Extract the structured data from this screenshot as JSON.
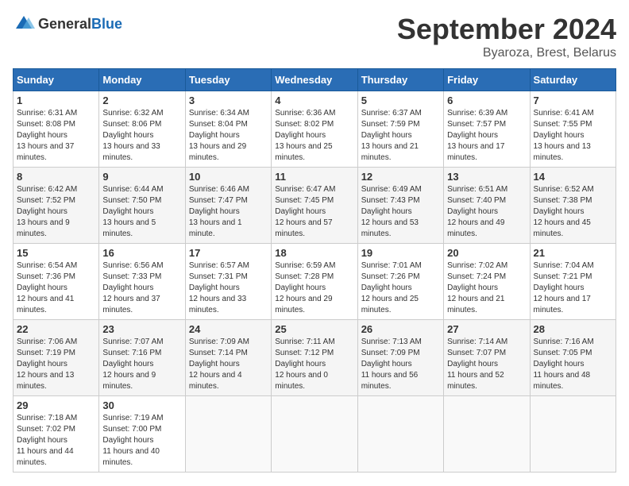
{
  "header": {
    "logo_general": "General",
    "logo_blue": "Blue",
    "month": "September 2024",
    "location": "Byaroza, Brest, Belarus"
  },
  "days_of_week": [
    "Sunday",
    "Monday",
    "Tuesday",
    "Wednesday",
    "Thursday",
    "Friday",
    "Saturday"
  ],
  "weeks": [
    [
      {
        "day": 1,
        "sunrise": "6:31 AM",
        "sunset": "8:08 PM",
        "daylight": "13 hours and 37 minutes."
      },
      {
        "day": 2,
        "sunrise": "6:32 AM",
        "sunset": "8:06 PM",
        "daylight": "13 hours and 33 minutes."
      },
      {
        "day": 3,
        "sunrise": "6:34 AM",
        "sunset": "8:04 PM",
        "daylight": "13 hours and 29 minutes."
      },
      {
        "day": 4,
        "sunrise": "6:36 AM",
        "sunset": "8:02 PM",
        "daylight": "13 hours and 25 minutes."
      },
      {
        "day": 5,
        "sunrise": "6:37 AM",
        "sunset": "7:59 PM",
        "daylight": "13 hours and 21 minutes."
      },
      {
        "day": 6,
        "sunrise": "6:39 AM",
        "sunset": "7:57 PM",
        "daylight": "13 hours and 17 minutes."
      },
      {
        "day": 7,
        "sunrise": "6:41 AM",
        "sunset": "7:55 PM",
        "daylight": "13 hours and 13 minutes."
      }
    ],
    [
      {
        "day": 8,
        "sunrise": "6:42 AM",
        "sunset": "7:52 PM",
        "daylight": "13 hours and 9 minutes."
      },
      {
        "day": 9,
        "sunrise": "6:44 AM",
        "sunset": "7:50 PM",
        "daylight": "13 hours and 5 minutes."
      },
      {
        "day": 10,
        "sunrise": "6:46 AM",
        "sunset": "7:47 PM",
        "daylight": "13 hours and 1 minute."
      },
      {
        "day": 11,
        "sunrise": "6:47 AM",
        "sunset": "7:45 PM",
        "daylight": "12 hours and 57 minutes."
      },
      {
        "day": 12,
        "sunrise": "6:49 AM",
        "sunset": "7:43 PM",
        "daylight": "12 hours and 53 minutes."
      },
      {
        "day": 13,
        "sunrise": "6:51 AM",
        "sunset": "7:40 PM",
        "daylight": "12 hours and 49 minutes."
      },
      {
        "day": 14,
        "sunrise": "6:52 AM",
        "sunset": "7:38 PM",
        "daylight": "12 hours and 45 minutes."
      }
    ],
    [
      {
        "day": 15,
        "sunrise": "6:54 AM",
        "sunset": "7:36 PM",
        "daylight": "12 hours and 41 minutes."
      },
      {
        "day": 16,
        "sunrise": "6:56 AM",
        "sunset": "7:33 PM",
        "daylight": "12 hours and 37 minutes."
      },
      {
        "day": 17,
        "sunrise": "6:57 AM",
        "sunset": "7:31 PM",
        "daylight": "12 hours and 33 minutes."
      },
      {
        "day": 18,
        "sunrise": "6:59 AM",
        "sunset": "7:28 PM",
        "daylight": "12 hours and 29 minutes."
      },
      {
        "day": 19,
        "sunrise": "7:01 AM",
        "sunset": "7:26 PM",
        "daylight": "12 hours and 25 minutes."
      },
      {
        "day": 20,
        "sunrise": "7:02 AM",
        "sunset": "7:24 PM",
        "daylight": "12 hours and 21 minutes."
      },
      {
        "day": 21,
        "sunrise": "7:04 AM",
        "sunset": "7:21 PM",
        "daylight": "12 hours and 17 minutes."
      }
    ],
    [
      {
        "day": 22,
        "sunrise": "7:06 AM",
        "sunset": "7:19 PM",
        "daylight": "12 hours and 13 minutes."
      },
      {
        "day": 23,
        "sunrise": "7:07 AM",
        "sunset": "7:16 PM",
        "daylight": "12 hours and 9 minutes."
      },
      {
        "day": 24,
        "sunrise": "7:09 AM",
        "sunset": "7:14 PM",
        "daylight": "12 hours and 4 minutes."
      },
      {
        "day": 25,
        "sunrise": "7:11 AM",
        "sunset": "7:12 PM",
        "daylight": "12 hours and 0 minutes."
      },
      {
        "day": 26,
        "sunrise": "7:13 AM",
        "sunset": "7:09 PM",
        "daylight": "11 hours and 56 minutes."
      },
      {
        "day": 27,
        "sunrise": "7:14 AM",
        "sunset": "7:07 PM",
        "daylight": "11 hours and 52 minutes."
      },
      {
        "day": 28,
        "sunrise": "7:16 AM",
        "sunset": "7:05 PM",
        "daylight": "11 hours and 48 minutes."
      }
    ],
    [
      {
        "day": 29,
        "sunrise": "7:18 AM",
        "sunset": "7:02 PM",
        "daylight": "11 hours and 44 minutes."
      },
      {
        "day": 30,
        "sunrise": "7:19 AM",
        "sunset": "7:00 PM",
        "daylight": "11 hours and 40 minutes."
      },
      null,
      null,
      null,
      null,
      null
    ]
  ]
}
